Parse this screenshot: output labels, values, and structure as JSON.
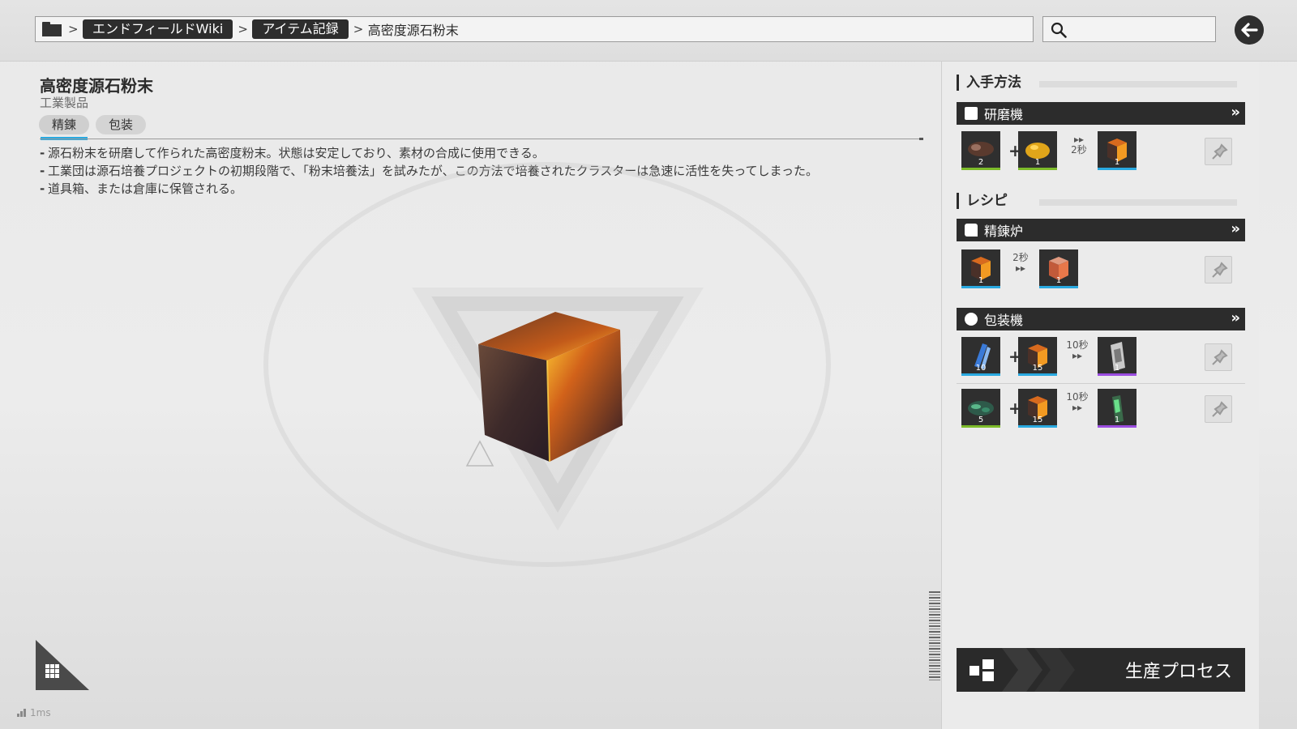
{
  "breadcrumb": {
    "items": [
      "エンドフィールドWiki",
      "アイテム記録"
    ],
    "current": "高密度源石粉末",
    "separator": ">"
  },
  "search": {
    "placeholder": "",
    "value": ""
  },
  "item": {
    "title": "高密度源石粉末",
    "category": "工業製品",
    "tabs": [
      "精錬",
      "包装"
    ],
    "active_tab": "精錬",
    "description": [
      "源石粉末を研磨して作られた高密度粉末。状態は安定しており、素材の合成に使用できる。",
      "工業団は源石培養プロジェクトの初期段階で、「粉末培養法」を試みたが、この方法で培養されたクラスターは急速に活性を失ってしまった。",
      "道具箱、または倉庫に保管される。"
    ]
  },
  "status": {
    "fps_text": "1ms"
  },
  "right_panel": {
    "acquisition": {
      "title": "入手方法",
      "machine": "研磨機",
      "recipe": {
        "inputs": [
          {
            "icon": "ore-chunk",
            "qty": "2",
            "bar_color": "#7dbb2a"
          },
          {
            "icon": "gold-nugget",
            "qty": "1",
            "bar_color": "#7dbb2a"
          }
        ],
        "time": "2秒",
        "output": {
          "icon": "orange-cube",
          "qty": "1",
          "bar_color": "#29a9e0"
        }
      }
    },
    "recipes": {
      "title": "レシピ",
      "groups": [
        {
          "machine": "精錬炉",
          "rows": [
            {
              "inputs": [
                {
                  "icon": "orange-cube",
                  "qty": "1",
                  "bar_color": "#29a9e0"
                }
              ],
              "time": "2秒",
              "output": {
                "icon": "red-cube",
                "qty": "1",
                "bar_color": "#29a9e0"
              }
            }
          ]
        },
        {
          "machine": "包装機",
          "rows": [
            {
              "inputs": [
                {
                  "icon": "blue-crystal-pack",
                  "qty": "10",
                  "bar_color": "#29a9e0"
                },
                {
                  "icon": "orange-cube",
                  "qty": "15",
                  "bar_color": "#29a9e0"
                }
              ],
              "time": "10秒",
              "output": {
                "icon": "metal-canister",
                "qty": "1",
                "bar_color": "#9b4de0"
              }
            },
            {
              "inputs": [
                {
                  "icon": "green-plant",
                  "qty": "5",
                  "bar_color": "#7dbb2a"
                },
                {
                  "icon": "orange-cube",
                  "qty": "15",
                  "bar_color": "#29a9e0"
                }
              ],
              "time": "10秒",
              "output": {
                "icon": "green-vial",
                "qty": "1",
                "bar_color": "#9b4de0"
              }
            }
          ]
        }
      ]
    },
    "production_button": "生産プロセス"
  },
  "colors": {
    "accent_blue": "#29a9e0",
    "dark": "#2c2c2c",
    "rarity_green": "#7dbb2a",
    "rarity_purple": "#9b4de0"
  }
}
